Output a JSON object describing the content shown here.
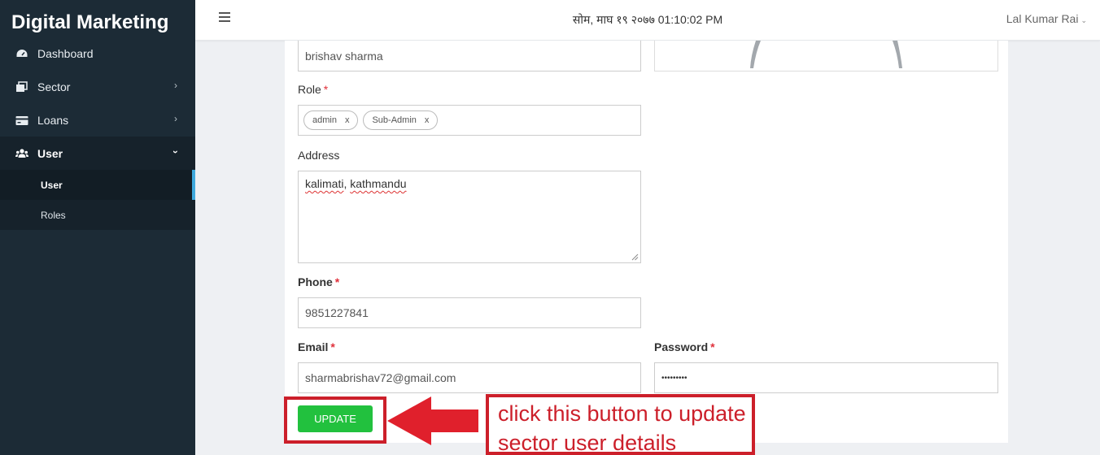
{
  "sidebar": {
    "brand": "Digital Marketing",
    "items": [
      {
        "label": "Dashboard",
        "icon": "dashboard-icon"
      },
      {
        "label": "Sector",
        "icon": "sector-icon"
      },
      {
        "label": "Loans",
        "icon": "loans-icon"
      },
      {
        "label": "User",
        "icon": "users-icon"
      }
    ],
    "sub_items": [
      {
        "label": "User"
      },
      {
        "label": "Roles"
      }
    ]
  },
  "header": {
    "datetime": "सोम, माघ १९ २०७७ 01:10:02 PM",
    "user_name": "Lal Kumar Rai"
  },
  "form": {
    "name_value": "brishav sharma",
    "role_label": "Role",
    "roles": [
      "admin",
      "Sub-Admin"
    ],
    "address_label": "Address",
    "address_value_1": "kalimati",
    "address_value_2": "kathmandu",
    "phone_label": "Phone",
    "phone_value": "9851227841",
    "email_label": "Email",
    "email_value": "sharmabrishav72@gmail.com",
    "password_label": "Password",
    "password_value": "•••••••••",
    "required_mark": "*",
    "update_label": "UPDATE"
  },
  "annotation": {
    "line1": "click this button to update",
    "line2": "sector user details"
  },
  "colors": {
    "sidebar_bg": "#1c2b36",
    "accent": "#3fa9dd",
    "update_button": "#22c13e",
    "annotation": "#cc1f2a",
    "required": "#e0303a"
  }
}
